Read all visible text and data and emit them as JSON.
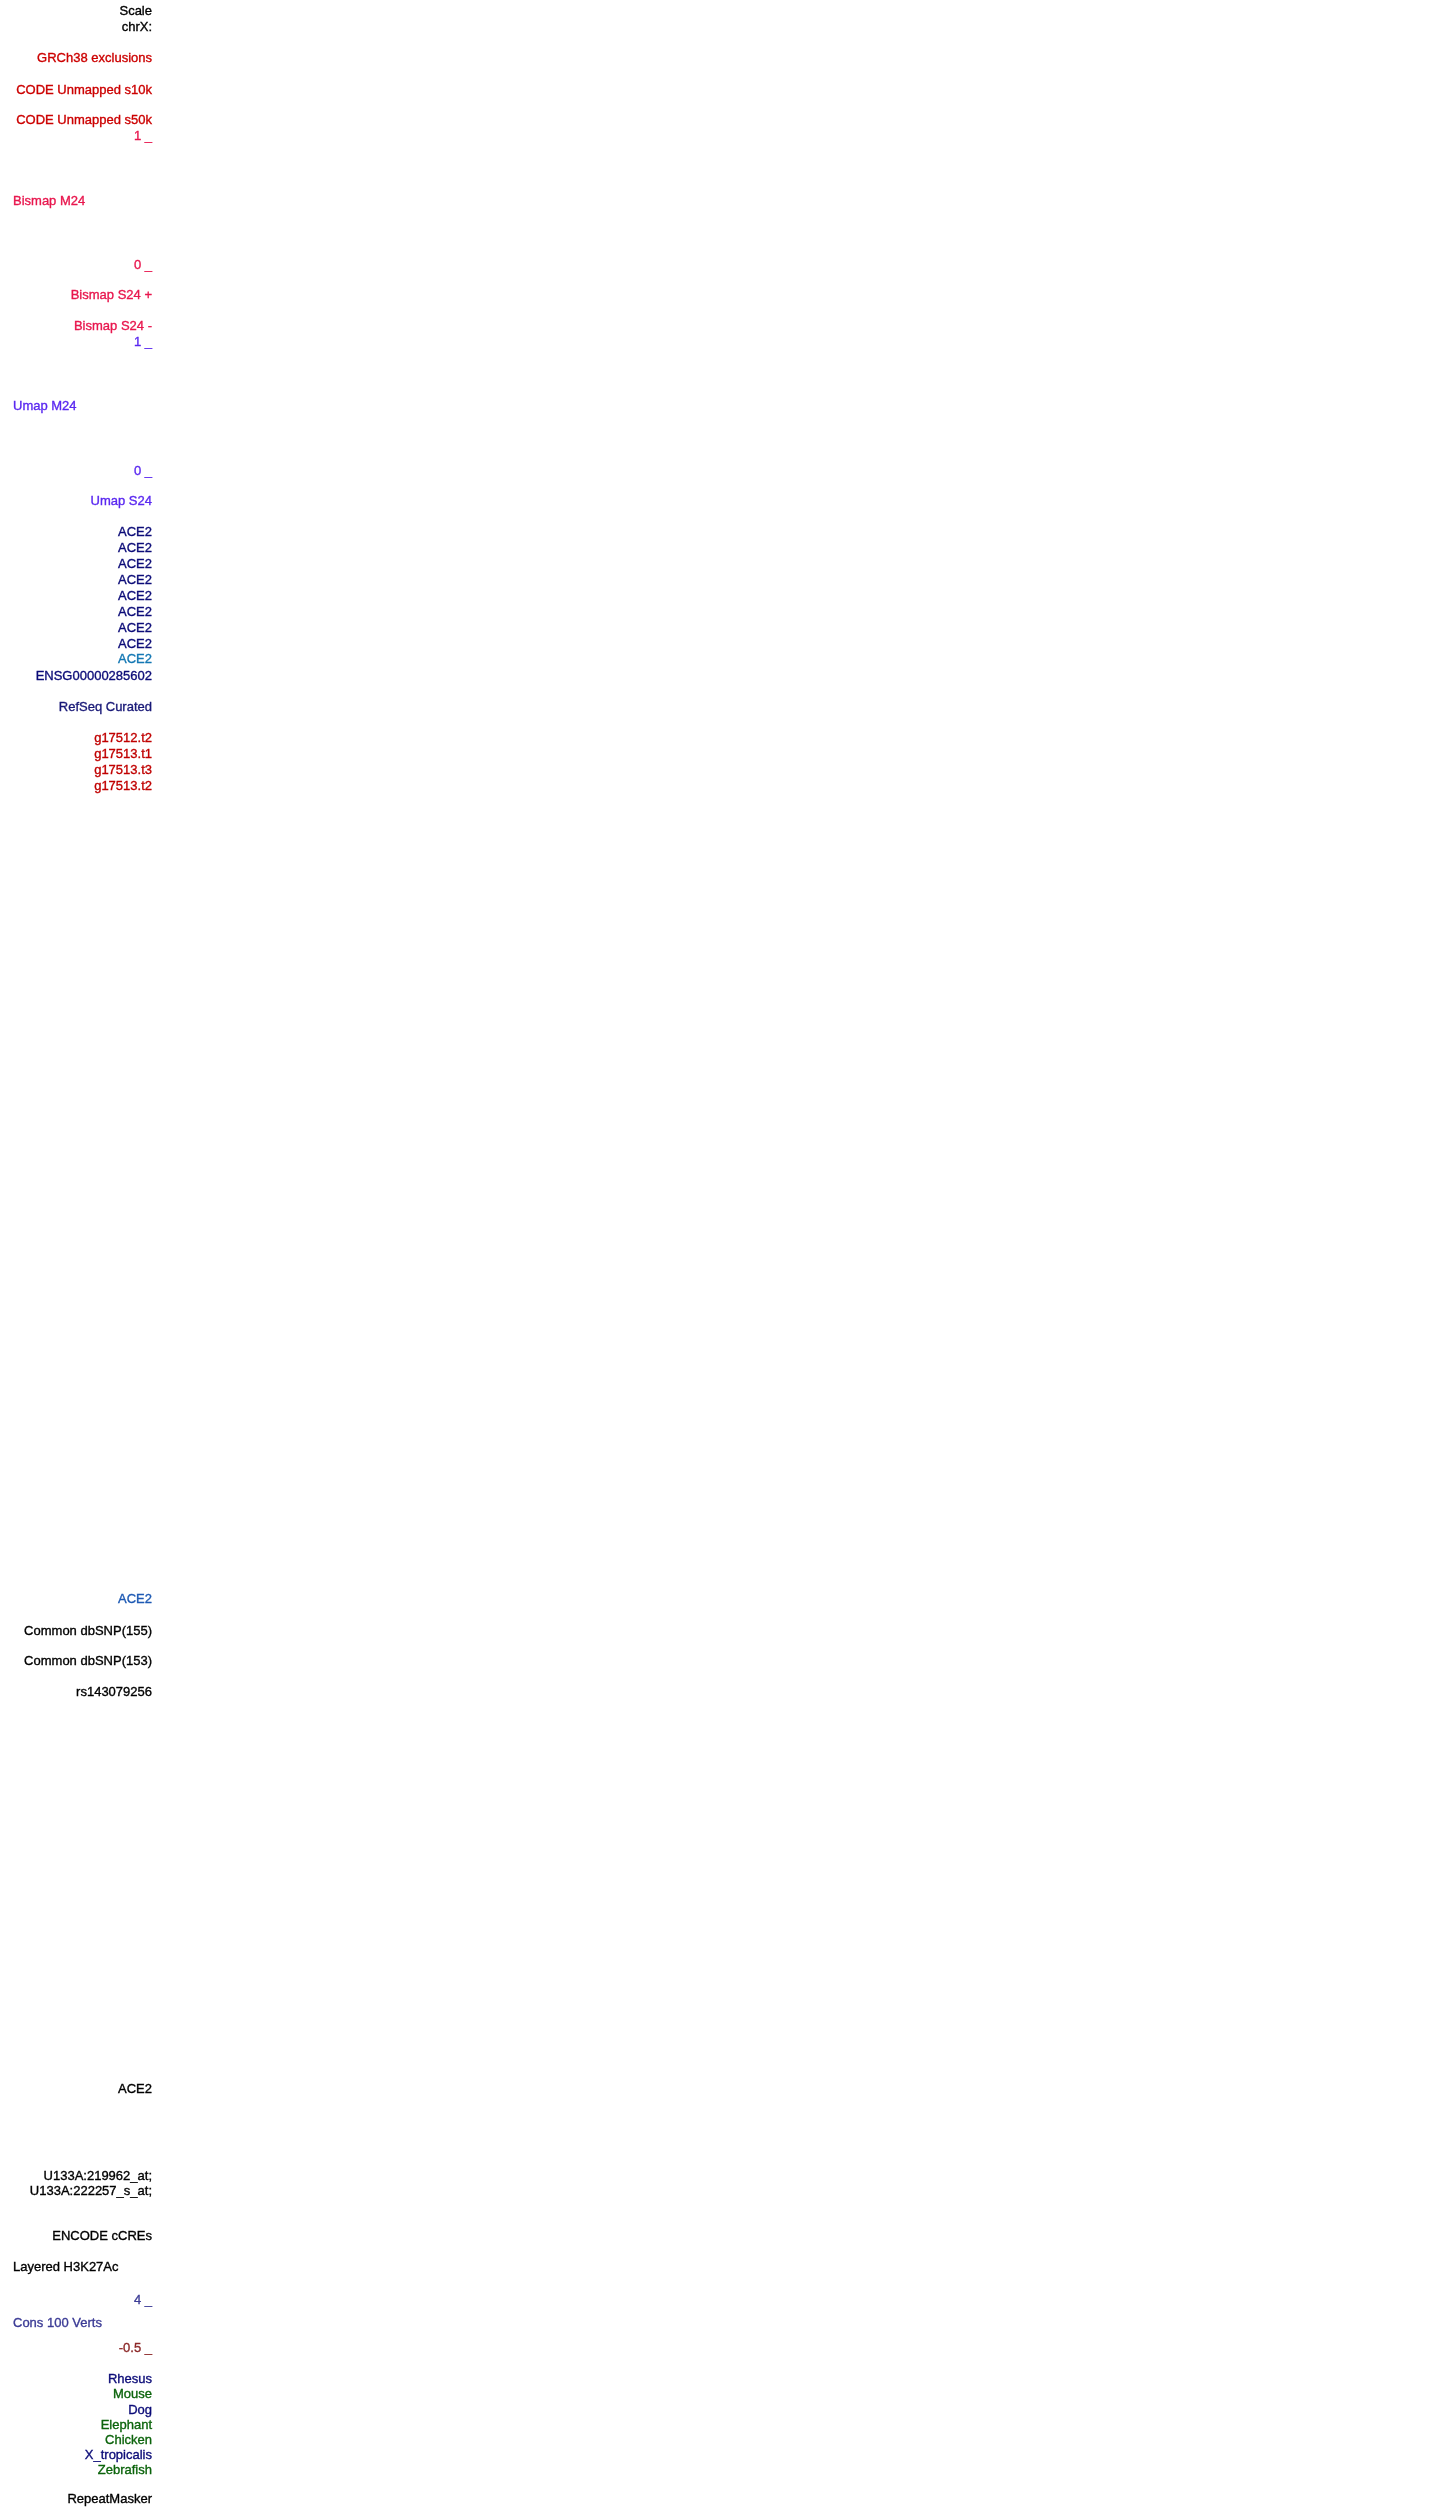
{
  "side_labels": [
    {
      "kind": "ruler",
      "text": "Scale",
      "color": "#000000"
    },
    {
      "kind": "ruler",
      "text": "chrX:",
      "color": "#000000"
    },
    {
      "kind": "track",
      "text": "GRCh38 exclusions",
      "color": "#cc0000"
    },
    {
      "kind": "track",
      "text": "CODE Unmapped s10k",
      "color": "#cc0000"
    },
    {
      "kind": "track",
      "text": "CODE Unmapped s50k",
      "color": "#cc0000"
    },
    {
      "kind": "axis",
      "text": "1 _",
      "color": "#e8174e"
    },
    {
      "kind": "title",
      "text": "Bismap M24",
      "color": "#e8174e"
    },
    {
      "kind": "axis",
      "text": "0 _",
      "color": "#e8174e"
    },
    {
      "kind": "track",
      "text": "Bismap S24 +",
      "color": "#e8174e"
    },
    {
      "kind": "track",
      "text": "Bismap S24 -",
      "color": "#e8174e"
    },
    {
      "kind": "axis",
      "text": "1 _",
      "color": "#5a28f0"
    },
    {
      "kind": "title",
      "text": "Umap M24",
      "color": "#5a28f0"
    },
    {
      "kind": "axis",
      "text": "0 _",
      "color": "#5a28f0"
    },
    {
      "kind": "track",
      "text": "Umap S24",
      "color": "#5a28f0"
    },
    {
      "kind": "item",
      "text": "ACE2",
      "color": "#0c0c78"
    },
    {
      "kind": "item",
      "text": "ACE2",
      "color": "#0c0c78"
    },
    {
      "kind": "item",
      "text": "ACE2",
      "color": "#0c0c78"
    },
    {
      "kind": "item",
      "text": "ACE2",
      "color": "#0c0c78"
    },
    {
      "kind": "item",
      "text": "ACE2",
      "color": "#0c0c78"
    },
    {
      "kind": "item",
      "text": "ACE2",
      "color": "#0c0c78"
    },
    {
      "kind": "item",
      "text": "ACE2",
      "color": "#0c0c78"
    },
    {
      "kind": "item",
      "text": "ACE2",
      "color": "#0c0c78"
    },
    {
      "kind": "item",
      "text": "ACE2",
      "color": "#1478b4"
    },
    {
      "kind": "item",
      "text": "ENSG00000285602",
      "color": "#0c0c78"
    },
    {
      "kind": "track",
      "text": "RefSeq Curated",
      "color": "#1a1a78"
    },
    {
      "kind": "item",
      "text": "g17512.t2",
      "color": "#c00000"
    },
    {
      "kind": "item",
      "text": "g17513.t1",
      "color": "#c00000"
    },
    {
      "kind": "item",
      "text": "g17513.t3",
      "color": "#c00000"
    },
    {
      "kind": "item",
      "text": "g17513.t2",
      "color": "#c00000"
    },
    {
      "kind": "item",
      "text": "ACE2",
      "color": "#1e5ab4"
    },
    {
      "kind": "track",
      "text": "Common dbSNP(155)",
      "color": "#000000"
    },
    {
      "kind": "track",
      "text": "Common dbSNP(153)",
      "color": "#000000"
    },
    {
      "kind": "item",
      "text": "rs143079256",
      "color": "#000000"
    },
    {
      "kind": "item",
      "text": "ACE2",
      "color": "#000000"
    },
    {
      "kind": "item",
      "text": "U133A:219962_at;",
      "color": "#000000"
    },
    {
      "kind": "item",
      "text": "U133A:222257_s_at;",
      "color": "#000000"
    },
    {
      "kind": "track",
      "text": "ENCODE cCREs",
      "color": "#000000"
    },
    {
      "kind": "title",
      "text": "Layered H3K27Ac",
      "color": "#000000"
    },
    {
      "kind": "axis",
      "text": "4 _",
      "color": "#3c3c96"
    },
    {
      "kind": "title",
      "text": "Cons 100 Verts",
      "color": "#3c3c96"
    },
    {
      "kind": "axis",
      "text": "-0.5 _",
      "color": "#8c2828"
    },
    {
      "kind": "species",
      "text": "Rhesus",
      "color": "#0c0c78"
    },
    {
      "kind": "species",
      "text": "Mouse",
      "color": "#0c640c"
    },
    {
      "kind": "species",
      "text": "Dog",
      "color": "#0c0c78"
    },
    {
      "kind": "species",
      "text": "Elephant",
      "color": "#0c640c"
    },
    {
      "kind": "species",
      "text": "Chicken",
      "color": "#0c640c"
    },
    {
      "kind": "species",
      "text": "X_tropicalis",
      "color": "#0c0c78"
    },
    {
      "kind": "species",
      "text": "Zebrafish",
      "color": "#0c640c"
    },
    {
      "kind": "track",
      "text": "RepeatMasker",
      "color": "#000000"
    }
  ]
}
